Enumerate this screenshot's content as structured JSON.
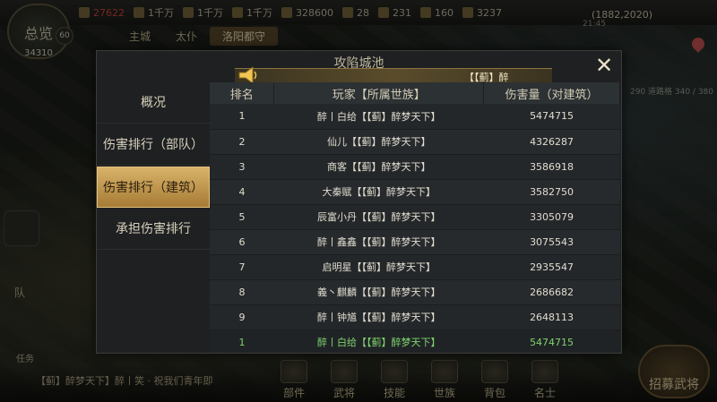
{
  "hud": {
    "resources": [
      {
        "value": "27622",
        "icon": "grain-icon",
        "warn": true
      },
      {
        "value": "1千万",
        "icon": "wood-icon",
        "warn": false
      },
      {
        "value": "1千万",
        "icon": "stone-icon",
        "warn": false
      },
      {
        "value": "1千万",
        "icon": "iron-icon",
        "warn": false
      },
      {
        "value": "328600",
        "icon": "copper-icon",
        "warn": false
      },
      {
        "value": "28",
        "icon": "gold-icon",
        "warn": false
      },
      {
        "value": "231",
        "icon": "gem-icon",
        "warn": false
      },
      {
        "value": "160",
        "icon": "token-icon",
        "warn": false
      },
      {
        "value": "3237",
        "icon": "honor-icon",
        "warn": false
      }
    ],
    "overview_label": "总览",
    "power": "34310",
    "level": "60",
    "coords": "(1882,2020)",
    "clock": "21:45",
    "subtabs": [
      "主城",
      "太仆",
      "洛阳都守"
    ],
    "side_note": "290 道路格 340 / 380",
    "team_label": "队",
    "task_label": "任务",
    "chat": "【蓟】醉梦天下】醉丨笑 · 祝我们青年即",
    "nav_items": [
      "部件",
      "武将",
      "技能",
      "世族",
      "背包",
      "名士"
    ],
    "recruit_label": "招募武将"
  },
  "modal": {
    "title": "攻陷城池",
    "banner_text": "【【蓟】醉",
    "close_symbol": "✕",
    "tabs": [
      {
        "label": "概况",
        "active": false
      },
      {
        "label": "伤害排行（部队）",
        "active": false
      },
      {
        "label": "伤害排行（建筑）",
        "active": true
      },
      {
        "label": "承担伤害排行",
        "active": false
      }
    ],
    "columns": [
      "排名",
      "玩家【所属世族】",
      "伤害量（对建筑）"
    ],
    "rows": [
      {
        "rank": "1",
        "player": "醉丨白给【【蓟】醉梦天下】",
        "damage": "5474715"
      },
      {
        "rank": "2",
        "player": "仙儿【【蓟】醉梦天下】",
        "damage": "4326287"
      },
      {
        "rank": "3",
        "player": "商客【【蓟】醉梦天下】",
        "damage": "3586918"
      },
      {
        "rank": "4",
        "player": "大秦赋【【蓟】醉梦天下】",
        "damage": "3582750"
      },
      {
        "rank": "5",
        "player": "辰富小丹【【蓟】醉梦天下】",
        "damage": "3305079"
      },
      {
        "rank": "6",
        "player": "醉丨鑫鑫【【蓟】醉梦天下】",
        "damage": "3075543"
      },
      {
        "rank": "7",
        "player": "启明星【【蓟】醉梦天下】",
        "damage": "2935547"
      },
      {
        "rank": "8",
        "player": "義丶麒麟【【蓟】醉梦天下】",
        "damage": "2686682"
      },
      {
        "rank": "9",
        "player": "醉丨钟馗【【蓟】醉梦天下】",
        "damage": "2648113"
      }
    ],
    "my_row": {
      "rank": "1",
      "player": "醉丨白给【【蓟】醉梦天下】",
      "damage": "5474715"
    }
  },
  "colors": {
    "active_tab": "#c89a4e",
    "my_row_text": "#7ed36f",
    "warn": "#d04a3a"
  }
}
